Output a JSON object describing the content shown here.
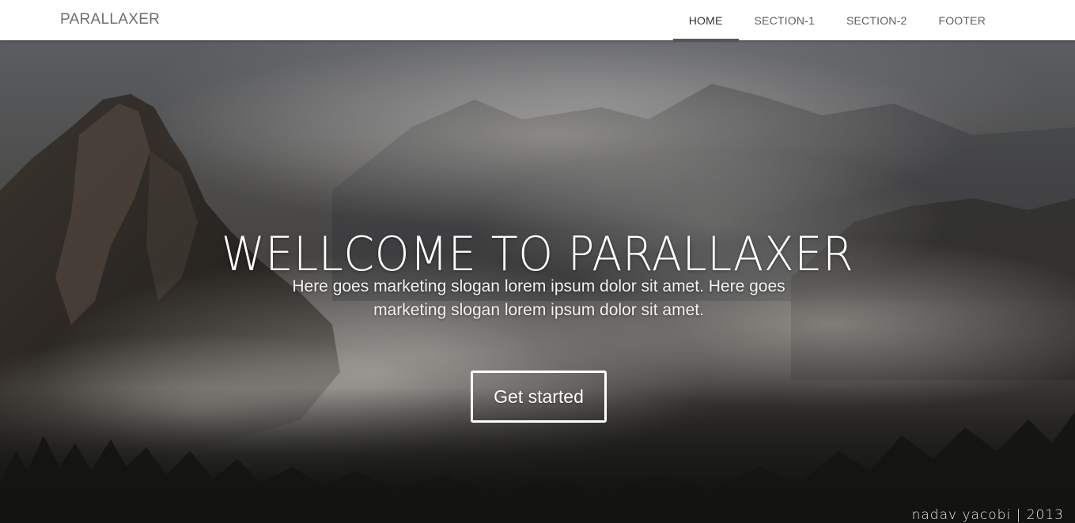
{
  "navbar": {
    "brand": "PARALLAXER",
    "items": [
      {
        "label": "HOME",
        "active": true
      },
      {
        "label": "SECTION-1",
        "active": false
      },
      {
        "label": "SECTION-2",
        "active": false
      },
      {
        "label": "FOOTER",
        "active": false
      }
    ]
  },
  "hero": {
    "title": "WELLCOME TO PARALLAXER",
    "slogan": "Here goes marketing slogan lorem ipsum dolor sit amet. Here goes marketing slogan lorem ipsum dolor sit amet.",
    "cta_label": "Get started",
    "photo_credit": "nadav yacobi | 2013"
  },
  "colors": {
    "navbar_bg": "#ffffff",
    "brand_text": "#6f6f6f",
    "active_underline": "#555555",
    "hero_text": "#ffffff"
  }
}
